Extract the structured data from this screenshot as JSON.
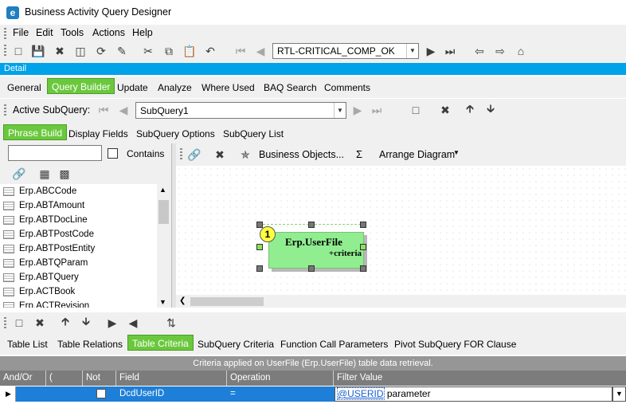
{
  "window": {
    "title": "Business Activity Query Designer",
    "icon": "e"
  },
  "menu": [
    "File",
    "Edit",
    "Tools",
    "Actions",
    "Help"
  ],
  "nav": {
    "current": "RTL-CRITICAL_COMP_OK"
  },
  "detail_label": "Detail",
  "main_tabs": [
    "General",
    "Query Builder",
    "Update",
    "Analyze",
    "Where Used",
    "BAQ Search",
    "Comments"
  ],
  "active_main_tab": "Query Builder",
  "subquery": {
    "label": "Active SubQuery:",
    "value": "SubQuery1"
  },
  "sub_tabs": [
    "Phrase Build",
    "Display Fields",
    "SubQuery Options",
    "SubQuery List"
  ],
  "search": {
    "value": "",
    "contains_label": "Contains"
  },
  "canvas_toolbar": {
    "business_objects": "Business Objects...",
    "sigma": "Σ",
    "arrange": "Arrange Diagram"
  },
  "tables": [
    "Erp.ABCCode",
    "Erp.ABTAmount",
    "Erp.ABTDocLine",
    "Erp.ABTPostCode",
    "Erp.ABTPostEntity",
    "Erp.ABTQParam",
    "Erp.ABTQuery",
    "Erp.ACTBook",
    "Erp.ACTRevision"
  ],
  "diagram": {
    "number": "1",
    "table": "Erp.UserFile",
    "sub": "+criteria"
  },
  "bottom_tabs": [
    "Table List",
    "Table Relations",
    "Table Criteria",
    "SubQuery Criteria",
    "Function Call Parameters",
    "Pivot SubQuery FOR Clause"
  ],
  "active_bottom_tab": "Table Criteria",
  "criteria_caption": "Criteria applied on UserFile (Erp.UserFile)  table data retrieval.",
  "grid": {
    "headers": [
      "And/Or",
      "(",
      "Not",
      "Field",
      "Operation",
      "Filter Value"
    ],
    "row": {
      "field": "DcdUserID",
      "operation": "=",
      "filter_link": "@USERID",
      "filter_rest": "parameter"
    }
  }
}
